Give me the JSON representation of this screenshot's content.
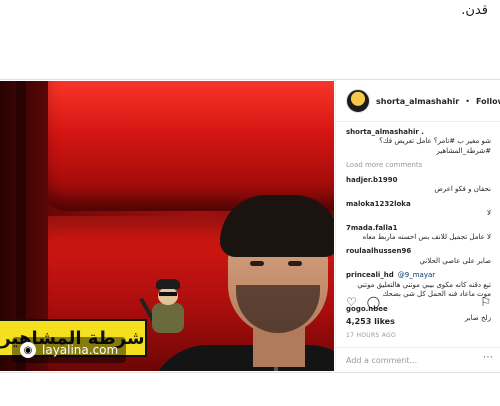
{
  "page": {
    "top_text": "قدن."
  },
  "image": {
    "banner_text": "شرطة المشاهير",
    "watermark_text": "layalina.com"
  },
  "post": {
    "username": "shorta_almashahir",
    "follow_label": "Following",
    "caption_user": "shorta_almashahir .",
    "caption_text": "شو مغير ب #تامر؟ عامل تعريض فك؟ #شرطة_المشاهير",
    "load_more": "Load more comments",
    "comments": [
      {
        "user": "hadjer.b1990",
        "text": "نحفان و فكو اعرض"
      },
      {
        "user": "maloka1232loka",
        "text": "لا"
      },
      {
        "user": "7mada.falla1",
        "text": "لا عامل تجميل للانف بس احسنه ماربط معاه"
      },
      {
        "user": "roulaalhussen96",
        "text": "صابر على عاصي الحلاني"
      },
      {
        "user": "princeali_hd",
        "mention": "@9_mayar",
        "text": "تبع دقنه كانه مكوى بيبي موتني هالتعليق موتني موت ماعاد فنه الحمل كل شي بضحك"
      },
      {
        "user": "gogo.nbee",
        "text": "زلخ صابر"
      }
    ],
    "likes": "4,253 likes",
    "time": "17 HOURS AGO",
    "add_comment_placeholder": "Add a comment..."
  },
  "icons": {
    "heart": "heart-icon",
    "comment": "comment-icon",
    "bookmark": "bookmark-icon",
    "more": "more-options-icon"
  }
}
